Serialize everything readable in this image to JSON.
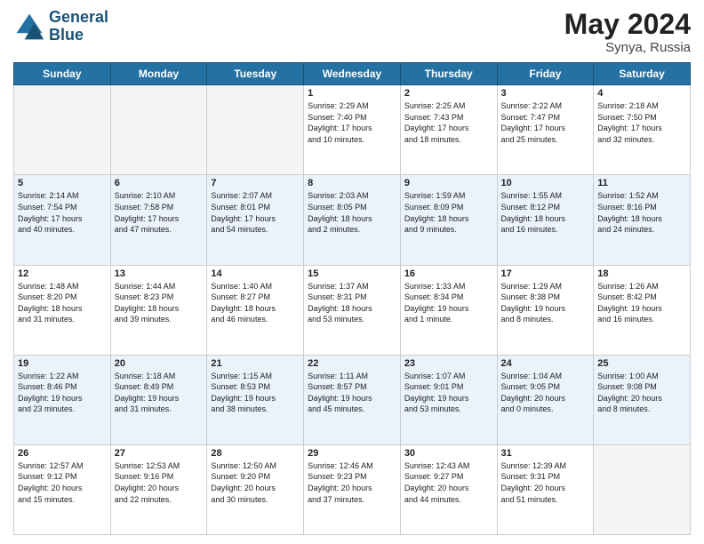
{
  "header": {
    "logo_line1": "General",
    "logo_line2": "Blue",
    "month_title": "May 2024",
    "location": "Synya, Russia"
  },
  "weekdays": [
    "Sunday",
    "Monday",
    "Tuesday",
    "Wednesday",
    "Thursday",
    "Friday",
    "Saturday"
  ],
  "weeks": [
    [
      {
        "day": "",
        "info": ""
      },
      {
        "day": "",
        "info": ""
      },
      {
        "day": "",
        "info": ""
      },
      {
        "day": "1",
        "info": "Sunrise: 2:29 AM\nSunset: 7:40 PM\nDaylight: 17 hours\nand 10 minutes."
      },
      {
        "day": "2",
        "info": "Sunrise: 2:25 AM\nSunset: 7:43 PM\nDaylight: 17 hours\nand 18 minutes."
      },
      {
        "day": "3",
        "info": "Sunrise: 2:22 AM\nSunset: 7:47 PM\nDaylight: 17 hours\nand 25 minutes."
      },
      {
        "day": "4",
        "info": "Sunrise: 2:18 AM\nSunset: 7:50 PM\nDaylight: 17 hours\nand 32 minutes."
      }
    ],
    [
      {
        "day": "5",
        "info": "Sunrise: 2:14 AM\nSunset: 7:54 PM\nDaylight: 17 hours\nand 40 minutes."
      },
      {
        "day": "6",
        "info": "Sunrise: 2:10 AM\nSunset: 7:58 PM\nDaylight: 17 hours\nand 47 minutes."
      },
      {
        "day": "7",
        "info": "Sunrise: 2:07 AM\nSunset: 8:01 PM\nDaylight: 17 hours\nand 54 minutes."
      },
      {
        "day": "8",
        "info": "Sunrise: 2:03 AM\nSunset: 8:05 PM\nDaylight: 18 hours\nand 2 minutes."
      },
      {
        "day": "9",
        "info": "Sunrise: 1:59 AM\nSunset: 8:09 PM\nDaylight: 18 hours\nand 9 minutes."
      },
      {
        "day": "10",
        "info": "Sunrise: 1:55 AM\nSunset: 8:12 PM\nDaylight: 18 hours\nand 16 minutes."
      },
      {
        "day": "11",
        "info": "Sunrise: 1:52 AM\nSunset: 8:16 PM\nDaylight: 18 hours\nand 24 minutes."
      }
    ],
    [
      {
        "day": "12",
        "info": "Sunrise: 1:48 AM\nSunset: 8:20 PM\nDaylight: 18 hours\nand 31 minutes."
      },
      {
        "day": "13",
        "info": "Sunrise: 1:44 AM\nSunset: 8:23 PM\nDaylight: 18 hours\nand 39 minutes."
      },
      {
        "day": "14",
        "info": "Sunrise: 1:40 AM\nSunset: 8:27 PM\nDaylight: 18 hours\nand 46 minutes."
      },
      {
        "day": "15",
        "info": "Sunrise: 1:37 AM\nSunset: 8:31 PM\nDaylight: 18 hours\nand 53 minutes."
      },
      {
        "day": "16",
        "info": "Sunrise: 1:33 AM\nSunset: 8:34 PM\nDaylight: 19 hours\nand 1 minute."
      },
      {
        "day": "17",
        "info": "Sunrise: 1:29 AM\nSunset: 8:38 PM\nDaylight: 19 hours\nand 8 minutes."
      },
      {
        "day": "18",
        "info": "Sunrise: 1:26 AM\nSunset: 8:42 PM\nDaylight: 19 hours\nand 16 minutes."
      }
    ],
    [
      {
        "day": "19",
        "info": "Sunrise: 1:22 AM\nSunset: 8:46 PM\nDaylight: 19 hours\nand 23 minutes."
      },
      {
        "day": "20",
        "info": "Sunrise: 1:18 AM\nSunset: 8:49 PM\nDaylight: 19 hours\nand 31 minutes."
      },
      {
        "day": "21",
        "info": "Sunrise: 1:15 AM\nSunset: 8:53 PM\nDaylight: 19 hours\nand 38 minutes."
      },
      {
        "day": "22",
        "info": "Sunrise: 1:11 AM\nSunset: 8:57 PM\nDaylight: 19 hours\nand 45 minutes."
      },
      {
        "day": "23",
        "info": "Sunrise: 1:07 AM\nSunset: 9:01 PM\nDaylight: 19 hours\nand 53 minutes."
      },
      {
        "day": "24",
        "info": "Sunrise: 1:04 AM\nSunset: 9:05 PM\nDaylight: 20 hours\nand 0 minutes."
      },
      {
        "day": "25",
        "info": "Sunrise: 1:00 AM\nSunset: 9:08 PM\nDaylight: 20 hours\nand 8 minutes."
      }
    ],
    [
      {
        "day": "26",
        "info": "Sunrise: 12:57 AM\nSunset: 9:12 PM\nDaylight: 20 hours\nand 15 minutes."
      },
      {
        "day": "27",
        "info": "Sunrise: 12:53 AM\nSunset: 9:16 PM\nDaylight: 20 hours\nand 22 minutes."
      },
      {
        "day": "28",
        "info": "Sunrise: 12:50 AM\nSunset: 9:20 PM\nDaylight: 20 hours\nand 30 minutes."
      },
      {
        "day": "29",
        "info": "Sunrise: 12:46 AM\nSunset: 9:23 PM\nDaylight: 20 hours\nand 37 minutes."
      },
      {
        "day": "30",
        "info": "Sunrise: 12:43 AM\nSunset: 9:27 PM\nDaylight: 20 hours\nand 44 minutes."
      },
      {
        "day": "31",
        "info": "Sunrise: 12:39 AM\nSunset: 9:31 PM\nDaylight: 20 hours\nand 51 minutes."
      },
      {
        "day": "",
        "info": ""
      }
    ]
  ]
}
